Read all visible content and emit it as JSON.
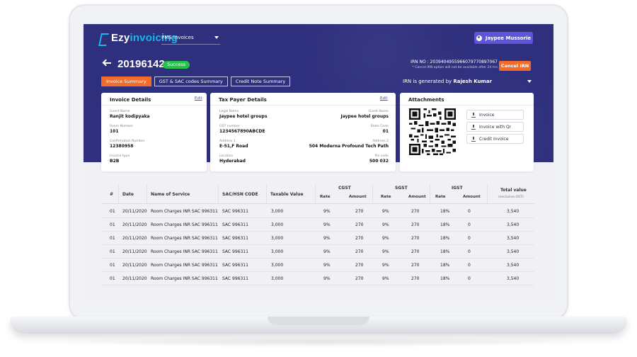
{
  "app": {
    "logo_prefix": "Ezy",
    "logo_suffix": "invoicing",
    "product": "PMS Invoices",
    "user": "Jaypee Mussorie"
  },
  "invoice": {
    "number": "20196142",
    "status": "Success",
    "irn_no": "IRN NO : 2039404955966079770897067",
    "irn_note": "* Cancel IRN option will not be available after 24 hrs",
    "cancel_label": "Cancel IRN",
    "irn_generated_prefix": "IRN is generated by",
    "irn_generated_by": "Rajesh Kumar"
  },
  "tabs": [
    {
      "label": "Invoice Summary",
      "active": true
    },
    {
      "label": "GST & SAC codes Summary",
      "active": false
    },
    {
      "label": "Credit Note Summary",
      "active": false
    }
  ],
  "invoice_details": {
    "title": "Invoice Details",
    "edit": "Edit",
    "fields": [
      {
        "label": "Guest Name",
        "value": "Ranjit kodipyaka"
      },
      {
        "label": "Room Number",
        "value": "101"
      },
      {
        "label": "Confirmation Number",
        "value": "12380958"
      },
      {
        "label": "Invoice type",
        "value": "B2B"
      }
    ]
  },
  "tax_payer": {
    "title": "Tax Payer Details",
    "edit": "Edit",
    "left": [
      {
        "label": "Legal Name",
        "value": "Jaypee hotel groups"
      },
      {
        "label": "GST number",
        "value": "1234567890ABCDE"
      },
      {
        "label": "Address 1",
        "value": "E-51,F Road"
      },
      {
        "label": "Location",
        "value": "Hyderabad"
      }
    ],
    "right": [
      {
        "label": "Guest Name",
        "value": "Jaypee hotel groups"
      },
      {
        "label": "State Code",
        "value": "01"
      },
      {
        "label": "Address 2",
        "value": "504 Moderna Profound Tech Path"
      },
      {
        "label": "Pin code",
        "value": "500 032"
      }
    ]
  },
  "attachments": {
    "title": "Attachments",
    "buttons": [
      "Invoice",
      "Invoice with Qr",
      "Credit Invoice"
    ]
  },
  "table": {
    "headers": {
      "num": "#",
      "date": "Date",
      "service": "Name of Service",
      "sac": "SAC/HSN CODE",
      "taxable": "Taxable Value",
      "cgst": "CGST",
      "sgst": "SGST",
      "igst": "IGST",
      "total": "Total value",
      "total_note": "(exclusive.GST)",
      "rate": "Rate",
      "amount": "Amount"
    },
    "rows": [
      {
        "num": "01",
        "date": "20/11/2020",
        "service": "Room Charges INR SAC 996311",
        "sac": "SAC 996311",
        "taxable": "3,000",
        "cgst_rate": "9%",
        "cgst_amt": "270",
        "sgst_rate": "9%",
        "sgst_amt": "270",
        "igst_rate": "18%",
        "igst_amt": "0",
        "total": "3,540"
      },
      {
        "num": "01",
        "date": "20/11/2020",
        "service": "Room Charges INR SAC 996311",
        "sac": "SAC 996311",
        "taxable": "3,000",
        "cgst_rate": "9%",
        "cgst_amt": "270",
        "sgst_rate": "9%",
        "sgst_amt": "270",
        "igst_rate": "18%",
        "igst_amt": "0",
        "total": "3,540"
      },
      {
        "num": "01",
        "date": "20/11/2020",
        "service": "Room Charges INR SAC 996311",
        "sac": "SAC 996311",
        "taxable": "3,000",
        "cgst_rate": "9%",
        "cgst_amt": "270",
        "sgst_rate": "9%",
        "sgst_amt": "270",
        "igst_rate": "18%",
        "igst_amt": "0",
        "total": "3,540"
      },
      {
        "num": "01",
        "date": "20/11/2020",
        "service": "Room Charges INR SAC 996311",
        "sac": "SAC 996311",
        "taxable": "3,000",
        "cgst_rate": "9%",
        "cgst_amt": "270",
        "sgst_rate": "9%",
        "sgst_amt": "270",
        "igst_rate": "18%",
        "igst_amt": "0",
        "total": "3,540"
      },
      {
        "num": "01",
        "date": "20/11/2020",
        "service": "Room Charges INR SAC 996311",
        "sac": "SAC 996311",
        "taxable": "3,000",
        "cgst_rate": "9%",
        "cgst_amt": "270",
        "sgst_rate": "9%",
        "sgst_amt": "270",
        "igst_rate": "18%",
        "igst_amt": "0",
        "total": "3,540"
      },
      {
        "num": "01",
        "date": "20/11/2020",
        "service": "Room Charges INR SAC 996311",
        "sac": "SAC 996311",
        "taxable": "3,000",
        "cgst_rate": "9%",
        "cgst_amt": "270",
        "sgst_rate": "9%",
        "sgst_amt": "270",
        "igst_rate": "18%",
        "igst_amt": "0",
        "total": "3,540"
      }
    ]
  },
  "colors": {
    "header_bg": "#2e2f7d",
    "accent_orange": "#f36b2a",
    "success_green": "#23c34a",
    "user_button": "#5d55d6",
    "logo_blue": "#19b6e8"
  }
}
